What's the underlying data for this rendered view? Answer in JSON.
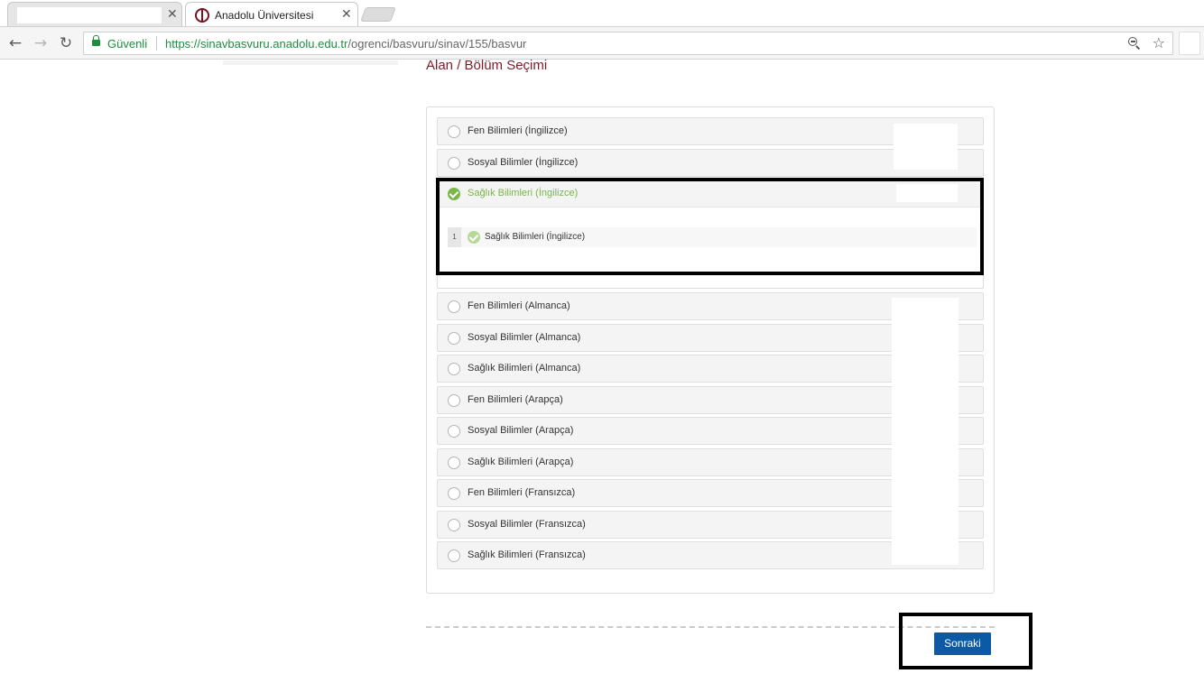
{
  "browser": {
    "tabs": [
      {
        "title": "",
        "close": "✕"
      },
      {
        "title": "Anadolu Üniversitesi",
        "close": "✕"
      }
    ],
    "toolbar": {
      "back": "←",
      "forward": "→",
      "reload": "↻",
      "secure_label": "Güvenli",
      "url_scheme": "https://",
      "url_host": "sinavbasvuru.anadolu.edu.tr",
      "url_path": "/ogrenci/basvuru/sinav/155/basvur",
      "star": "☆"
    }
  },
  "page": {
    "heading": "Alan / Bölüm Seçimi",
    "options_top": [
      {
        "label": "Fen Bilimleri (İngilizce)",
        "selected": false
      },
      {
        "label": "Sosyal Bilimler (İngilizce)",
        "selected": false
      }
    ],
    "selected_option": {
      "label": "Sağlık Bilimleri (İngilizce)",
      "sub_index": "1",
      "sub_label": "Sağlık Bilimleri (İngilizce)"
    },
    "options_bottom": [
      {
        "label": "Fen Bilimleri (Almanca)",
        "selected": false
      },
      {
        "label": "Sosyal Bilimler (Almanca)",
        "selected": false
      },
      {
        "label": "Sağlık Bilimleri (Almanca)",
        "selected": false
      },
      {
        "label": "Fen Bilimleri (Arapça)",
        "selected": false
      },
      {
        "label": "Sosyal Bilimler (Arapça)",
        "selected": false
      },
      {
        "label": "Sağlık Bilimleri (Arapça)",
        "selected": false
      },
      {
        "label": "Fen Bilimleri (Fransızca)",
        "selected": false
      },
      {
        "label": "Sosyal Bilimler (Fransızca)",
        "selected": false
      },
      {
        "label": "Sağlık Bilimleri (Fransızca)",
        "selected": false
      }
    ],
    "next_button": "Sonraki"
  },
  "colors": {
    "heading": "#7a1d2c",
    "selected_green": "#7ab648",
    "next_button_bg": "#0c5aa6",
    "secure_green": "#1e8e3e"
  }
}
